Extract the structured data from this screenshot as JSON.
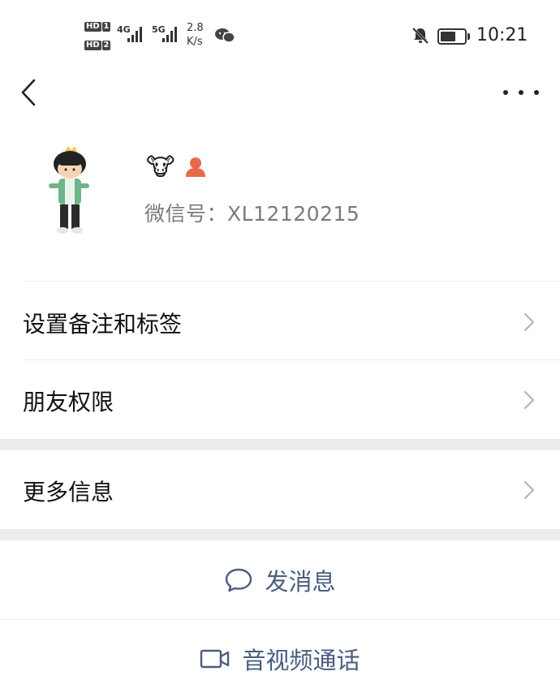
{
  "status_bar": {
    "hd1": "HD",
    "sim1": "1",
    "hd2": "HD",
    "sim2": "2",
    "network1": "4G",
    "network2": "5G",
    "speed_value": "2.8",
    "speed_unit": "K/s",
    "time": "10:21",
    "battery_level": 0.8
  },
  "profile": {
    "emoji_1": "🐮",
    "wechat_id": "微信号：XL12120215"
  },
  "menu": {
    "remark_tags": "设置备注和标签",
    "friend_permissions": "朋友权限",
    "more_info": "更多信息"
  },
  "actions": {
    "send_message": "发消息",
    "av_call": "音视频通话"
  },
  "colors": {
    "action_text": "#4a5d7d",
    "divider": "#ececec",
    "orange_icon": "#e8694a"
  },
  "icons": [
    "back-chevron-icon",
    "more-dots-icon",
    "mute-bell-icon",
    "battery-icon",
    "wechat-icon",
    "chevron-right-icon",
    "chat-bubble-icon",
    "video-camera-icon"
  ]
}
